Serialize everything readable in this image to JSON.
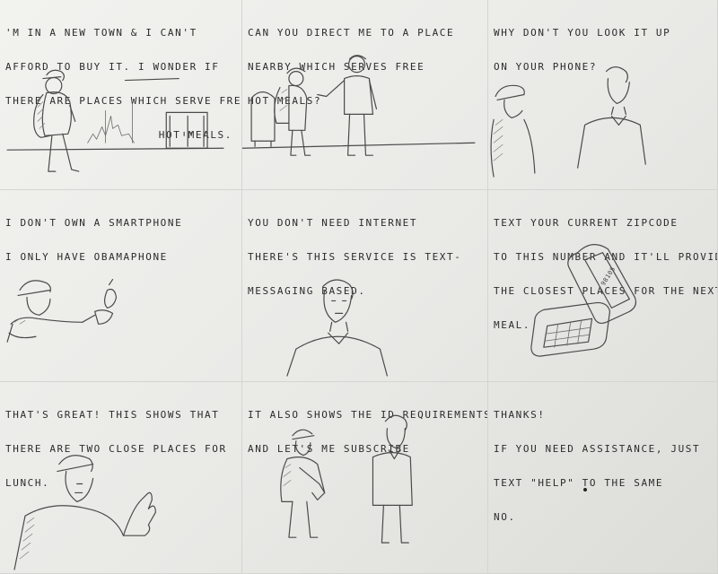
{
  "panels": [
    {
      "id": "p1",
      "lines": [
        "'m in a new town & I can't",
        "afford to buy it. I wonder if",
        "there are places which serve free"
      ],
      "right_line": "hot meals."
    },
    {
      "id": "p2",
      "lines": [
        "Can you direct me to a place",
        "nearby which serves free",
        "hot meals?"
      ]
    },
    {
      "id": "p3",
      "lines": [
        "Why don't you look it up",
        "on your phone?"
      ]
    },
    {
      "id": "p4",
      "lines": [
        "I don't own a smartphone",
        "I only have Obamaphone"
      ]
    },
    {
      "id": "p5",
      "lines": [
        "You don't need internet",
        "there's this service is text-",
        "messaging based."
      ]
    },
    {
      "id": "p6",
      "lines": [
        "Text your current zipcode",
        "to this number and it'll provide",
        "the closest places for the next",
        "meal."
      ],
      "phone_screen_text": "98105"
    },
    {
      "id": "p7",
      "lines": [
        "That's great! This shows that",
        "there are two close places for",
        "lunch."
      ]
    },
    {
      "id": "p8",
      "lines": [
        "It also shows the ID requirements",
        "and let's me subscribe"
      ]
    },
    {
      "id": "p9",
      "lines": [
        "Thanks!",
        "If you need assistance, just",
        "text \"help\" to the same",
        "no."
      ]
    }
  ]
}
